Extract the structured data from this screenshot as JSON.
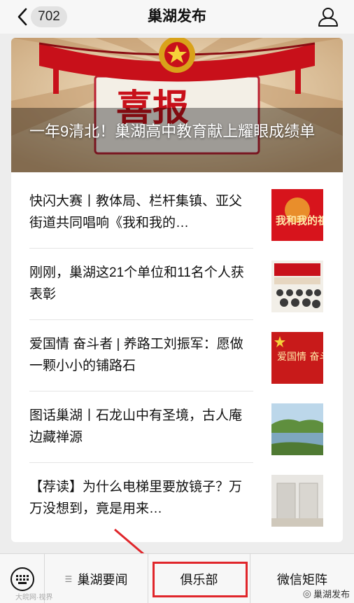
{
  "header": {
    "unread_count": "702",
    "title": "巢湖发布"
  },
  "hero": {
    "banner_text": "喜报",
    "headline": "一年9清北！巢湖高中教育献上耀眼成绩单"
  },
  "articles": [
    {
      "title": "快闪大赛丨教体局、栏杆集镇、亚父街道共同唱响《我和我的…",
      "thumb_text": "我和我的祖国"
    },
    {
      "title": "刚刚，巢湖这21个单位和11名个人获表彰",
      "thumb_text": ""
    },
    {
      "title": "爱国情 奋斗者 | 养路工刘振军：愿做一颗小小的铺路石",
      "thumb_text": "爱国情 奋斗者"
    },
    {
      "title": "图话巢湖丨石龙山中有圣境，古人庵边藏禅源",
      "thumb_text": ""
    },
    {
      "title": "【荐读】为什么电梯里要放镜子？万万没想到，竟是用来…",
      "thumb_text": ""
    }
  ],
  "bottom_menu": {
    "tab1": "巢湖要闻",
    "tab2": "俱乐部",
    "tab3": "微信矩阵"
  },
  "watermark": {
    "left": "大皖网·视界",
    "right": "巢湖发布"
  },
  "colors": {
    "highlight": "#e0262b",
    "banner_red": "#c8101a"
  }
}
